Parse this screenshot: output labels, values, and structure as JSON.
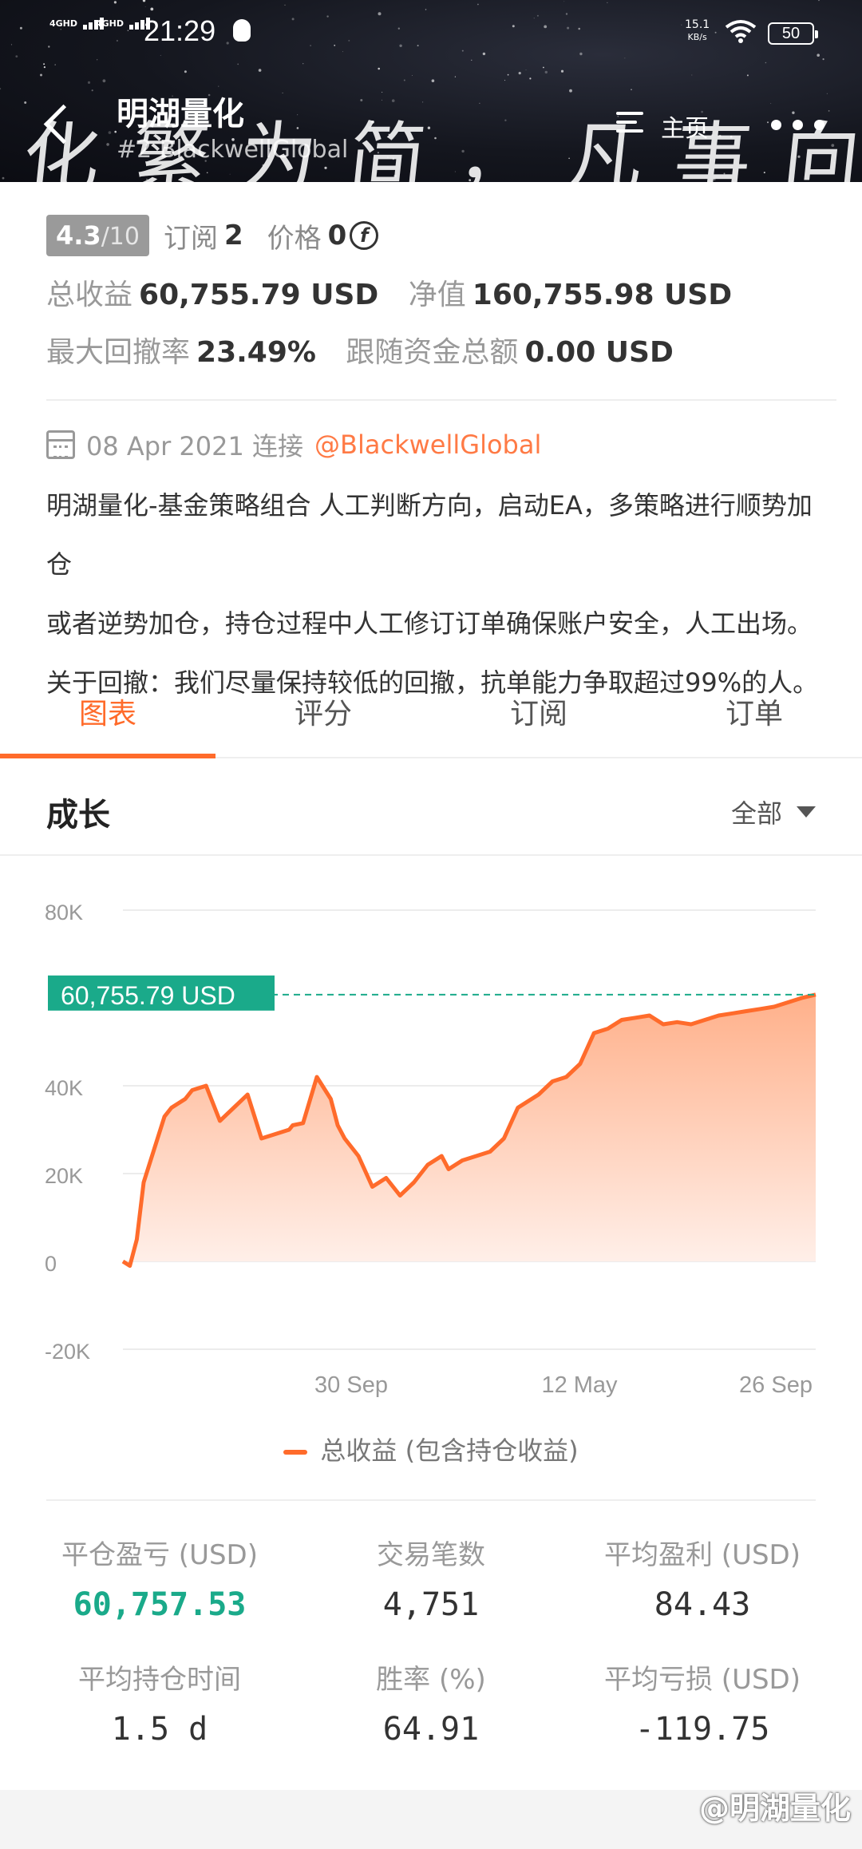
{
  "status_bar": {
    "signal1": "4GHD",
    "signal2": "4GHD",
    "time": "21:29",
    "speed_value": "15.1",
    "speed_unit": "KB/s",
    "battery": "50"
  },
  "header": {
    "banner_text": "化繁为简，凡事向内",
    "title": "明湖量化",
    "subtitle": "#2 BlackwellGlobal",
    "home_label": "主页"
  },
  "info": {
    "rating": "4.3",
    "rating_max": "/10",
    "subscribe_label": "订阅",
    "subscribe_count": "2",
    "price_label": "价格",
    "price_value": "0",
    "total_profit_label": "总收益",
    "total_profit_value": "60,755.79 USD",
    "equity_label": "净值",
    "equity_value": "160,755.98 USD",
    "max_drawdown_label": "最大回撤率",
    "max_drawdown_value": "23.49%",
    "follow_funds_label": "跟随资金总额",
    "follow_funds_value": "0.00 USD",
    "connected_date": "08 Apr 2021 连接",
    "broker": "@BlackwellGlobal",
    "desc_line1": "明湖量化-基金策略组合 人工判断方向，启动EA，多策略进行顺势加仓",
    "desc_line2": "或者逆势加仓，持仓过程中人工修订订单确保账户安全，人工出场。",
    "desc_line3": "关于回撤：我们尽量保持较低的回撤，抗单能力争取超过99%的人。"
  },
  "tabs": [
    {
      "label": "图表"
    },
    {
      "label": "评分"
    },
    {
      "label": "订阅"
    },
    {
      "label": "订单"
    }
  ],
  "growth": {
    "title": "成长",
    "range": "全部"
  },
  "chart_data": {
    "type": "area",
    "title": "",
    "current_value_label": "60,755.79 USD",
    "y_ticks": [
      "80K",
      "40K",
      "20K",
      "0",
      "-20K"
    ],
    "x_ticks": [
      "30 Sep",
      "12 May",
      "26 Sep"
    ],
    "ylim": [
      -20000,
      80000
    ],
    "legend": "总收益 (包含持仓收益)",
    "series": [
      {
        "name": "总收益 (包含持仓收益)",
        "x": [
          0,
          0.01,
          0.02,
          0.03,
          0.05,
          0.06,
          0.07,
          0.09,
          0.1,
          0.12,
          0.14,
          0.16,
          0.18,
          0.2,
          0.22,
          0.24,
          0.245,
          0.26,
          0.28,
          0.3,
          0.31,
          0.32,
          0.34,
          0.36,
          0.38,
          0.4,
          0.42,
          0.44,
          0.46,
          0.47,
          0.49,
          0.51,
          0.53,
          0.55,
          0.57,
          0.6,
          0.62,
          0.64,
          0.66,
          0.68,
          0.7,
          0.72,
          0.74,
          0.76,
          0.78,
          0.8,
          0.82,
          0.84,
          0.86,
          0.88,
          0.9,
          0.92,
          0.94,
          0.96,
          0.98,
          1.0
        ],
        "values": [
          0,
          -1000,
          5000,
          18000,
          28000,
          33000,
          35000,
          37000,
          39000,
          40000,
          32000,
          35000,
          38000,
          28000,
          29000,
          30000,
          31000,
          31500,
          42000,
          37000,
          31000,
          28000,
          24000,
          17000,
          19000,
          15000,
          18000,
          22000,
          24000,
          21000,
          23000,
          24000,
          25000,
          28000,
          35000,
          38000,
          41000,
          42000,
          45000,
          52000,
          53000,
          55000,
          55500,
          56000,
          54000,
          54500,
          54000,
          55000,
          56000,
          56500,
          57000,
          57500,
          58000,
          59000,
          60000,
          60755.79
        ]
      }
    ]
  },
  "stats": {
    "closed_pnl_label": "平仓盈亏 (USD)",
    "closed_pnl_value": "60,757.53",
    "trades_label": "交易笔数",
    "trades_value": "4,751",
    "avg_profit_label": "平均盈利 (USD)",
    "avg_profit_value": "84.43",
    "avg_hold_label": "平均持仓时间",
    "avg_hold_value": "1.5 d",
    "win_rate_label": "胜率 (%)",
    "win_rate_value": "64.91",
    "avg_loss_label": "平均亏损 (USD)",
    "avg_loss_value": "-119.75"
  },
  "watermark": "@明湖量化",
  "colors": {
    "accent": "#ff6b2b",
    "teal": "#1aaa8a",
    "banner": "#14161e"
  }
}
